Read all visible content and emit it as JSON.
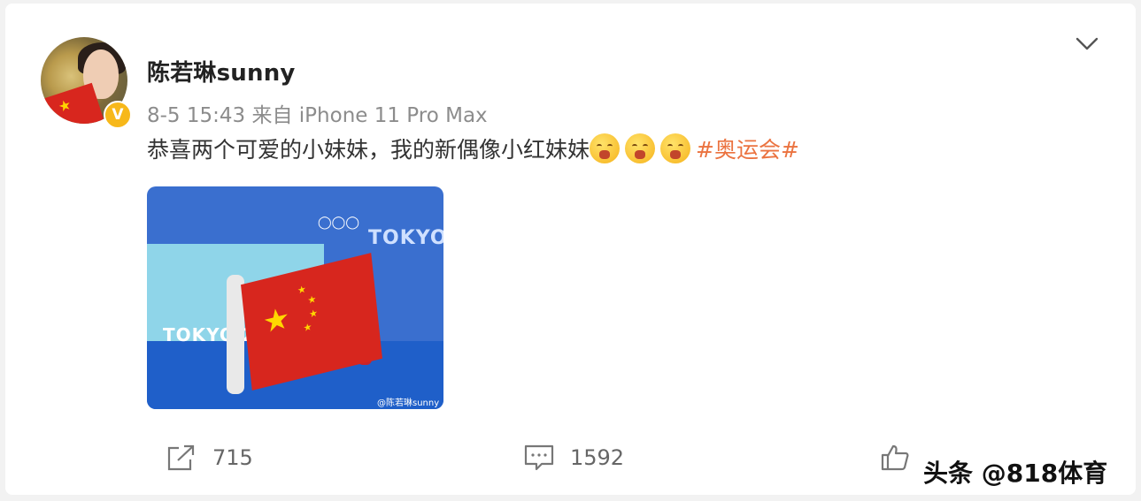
{
  "post": {
    "username": "陈若琳sunny",
    "meta": "8-5 15:43  来自 iPhone 11 Pro Max",
    "text": "恭喜两个可爱的小妹妹，我的新偶像小红妹妹",
    "emoji_count": 3,
    "emoji_icon": "pleading-face-icon",
    "hashtag": "#奥运会#",
    "verified_badge": "V",
    "badge_color": "#f7b81a",
    "hashtag_color": "#eb7340"
  },
  "photo": {
    "sign_left": "TOKYO 2020",
    "sign_right": "TOKYO",
    "watermark": "@陈若琳sunny"
  },
  "actions": {
    "repost_count": "715",
    "comment_count": "1592"
  },
  "branding": "头条 @818体育"
}
